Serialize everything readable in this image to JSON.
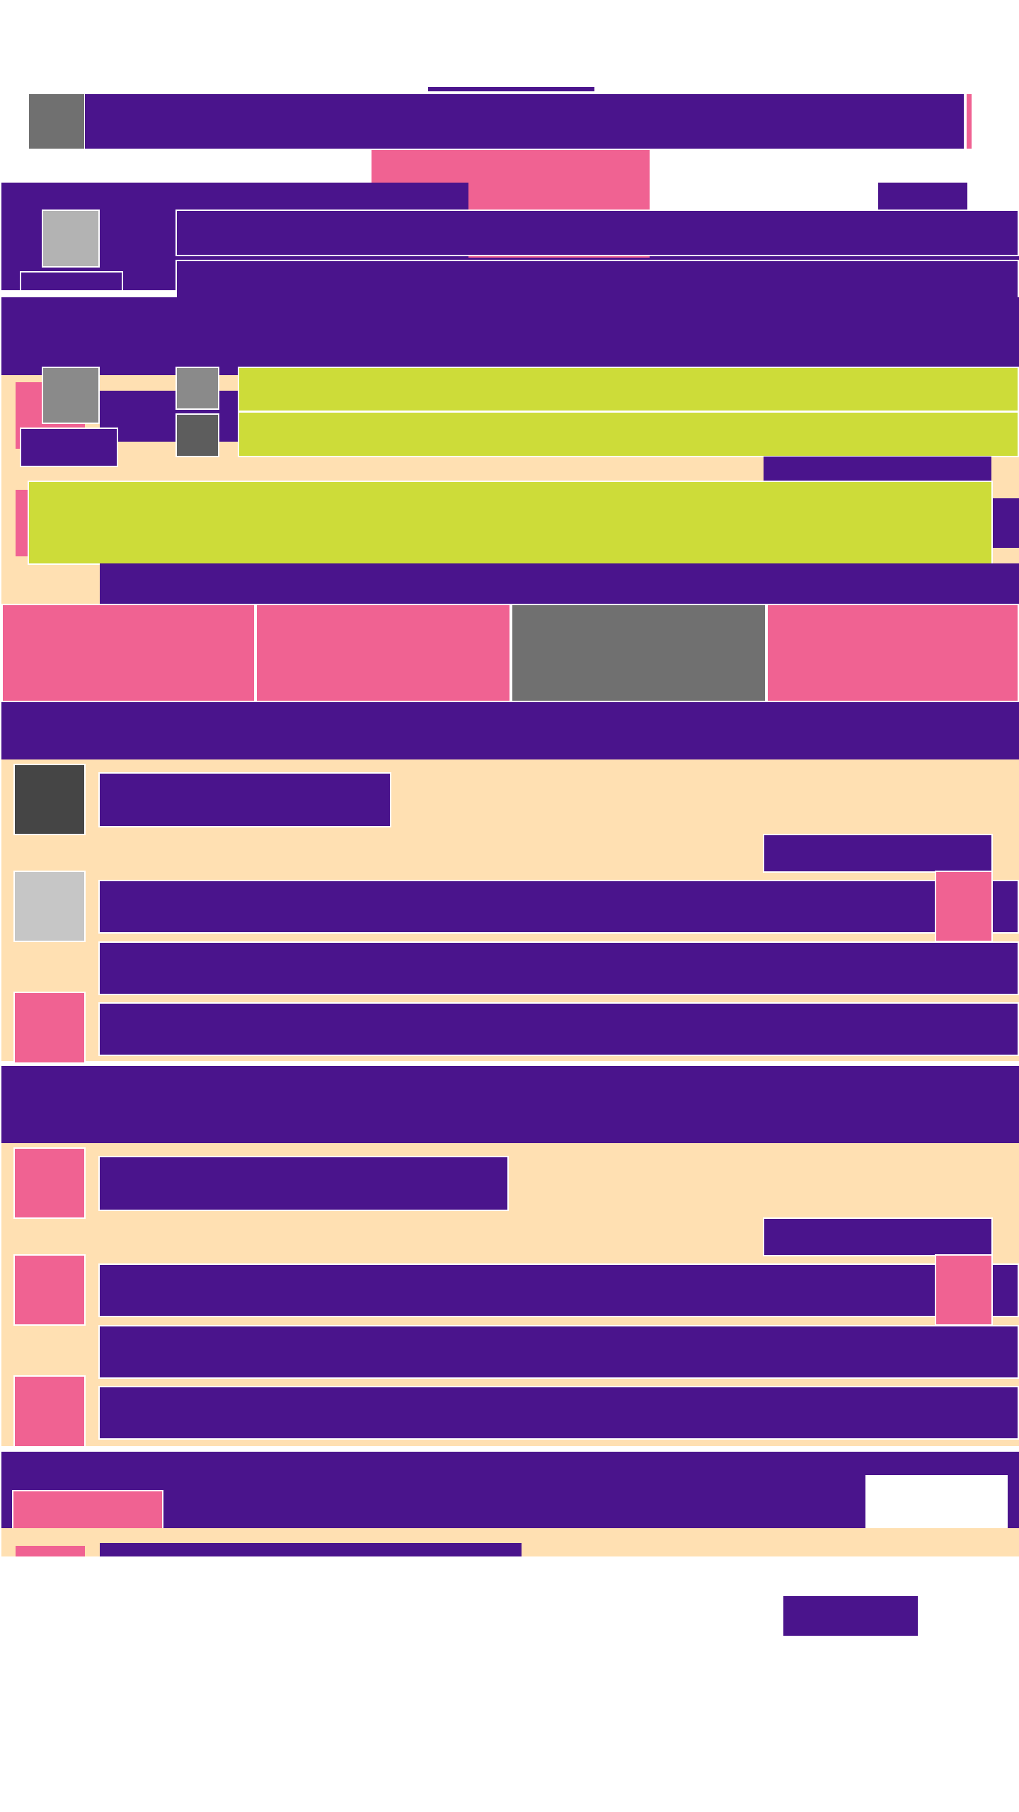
{
  "palette": {
    "primary": "#4a148c",
    "accent": "#f06292",
    "surface": "#ffe0b2",
    "highlight": "#cddc39",
    "background": "#ffffff",
    "placeholder_dark": "#454545",
    "placeholder_mid": "#707070",
    "placeholder_light": "#c6c6c6"
  },
  "note_visible_text": []
}
